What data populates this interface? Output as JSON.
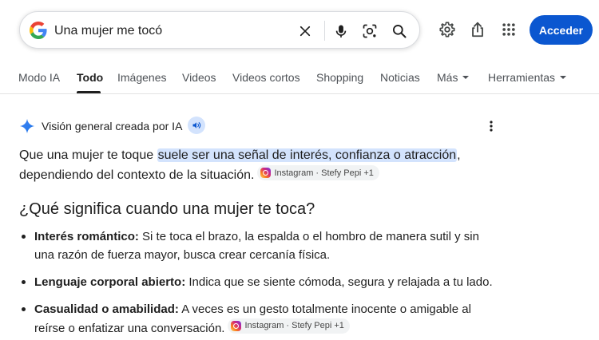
{
  "search": {
    "query": "Una mujer me tocó",
    "clear_icon": "close-icon",
    "voice_icon": "mic-icon",
    "lens_icon": "camera-lens-icon",
    "search_icon": "search-icon"
  },
  "header": {
    "settings_icon": "gear-icon",
    "share_icon": "share-icon",
    "apps_icon": "apps-grid-icon",
    "signin_label": "Acceder"
  },
  "tabs": [
    {
      "label": "Modo IA"
    },
    {
      "label": "Todo",
      "active": true
    },
    {
      "label": "Imágenes"
    },
    {
      "label": "Videos"
    },
    {
      "label": "Videos cortos"
    },
    {
      "label": "Shopping"
    },
    {
      "label": "Noticias"
    },
    {
      "label": "Más"
    },
    {
      "label": "Herramientas"
    }
  ],
  "ai_overview": {
    "title": "Visión general creada por IA",
    "intro_before": "Que una mujer te toque ",
    "intro_highlight": "suele ser una señal de interés, confianza o atracción",
    "intro_after": ", dependiendo del contexto de la situación.",
    "source_chip": "Instagram · Stefy Pepi +1",
    "heading": "¿Qué significa cuando una mujer te toca?",
    "bullets": [
      {
        "term": "Interés romántico:",
        "text": " Si te toca el brazo, la espalda o el hombro de manera sutil y sin una razón de fuerza mayor, busca crear cercanía física."
      },
      {
        "term": "Lenguaje corporal abierto:",
        "text": " Indica que se siente cómoda, segura y relajada a tu lado."
      },
      {
        "term": "Casualidad o amabilidad:",
        "text": " A veces es un gesto totalmente inocente o amigable al reírse o enfatizar una conversación.",
        "chip": "Instagram · Stefy Pepi +1"
      }
    ]
  },
  "colors": {
    "accent": "#0b57d0",
    "highlight": "#d3e3fd"
  }
}
